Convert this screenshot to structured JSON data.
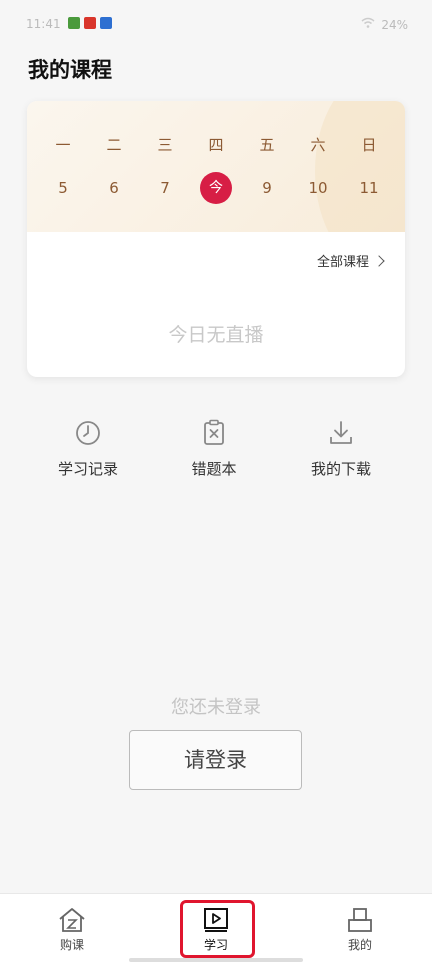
{
  "status_bar": {
    "time": "11:41",
    "battery": "24%"
  },
  "header": {
    "title": "我的课程"
  },
  "calendar": {
    "weekdays": [
      "一",
      "二",
      "三",
      "四",
      "五",
      "六",
      "日"
    ],
    "dates": [
      "5",
      "6",
      "7",
      "今",
      "9",
      "10",
      "11"
    ],
    "today_index": 3,
    "accent_color": "#d71e45"
  },
  "card": {
    "all_courses_label": "全部课程",
    "empty_text": "今日无直播"
  },
  "shortcuts": [
    {
      "label": "学习记录",
      "icon": "clock-icon"
    },
    {
      "label": "错题本",
      "icon": "wrong-questions-icon"
    },
    {
      "label": "我的下载",
      "icon": "download-icon"
    }
  ],
  "login": {
    "hint": "您还未登录",
    "button_label": "请登录"
  },
  "tabbar": {
    "items": [
      {
        "label": "购课",
        "icon": "home-shop-icon"
      },
      {
        "label": "学习",
        "icon": "play-icon",
        "active": true
      },
      {
        "label": "我的",
        "icon": "profile-icon"
      }
    ]
  }
}
